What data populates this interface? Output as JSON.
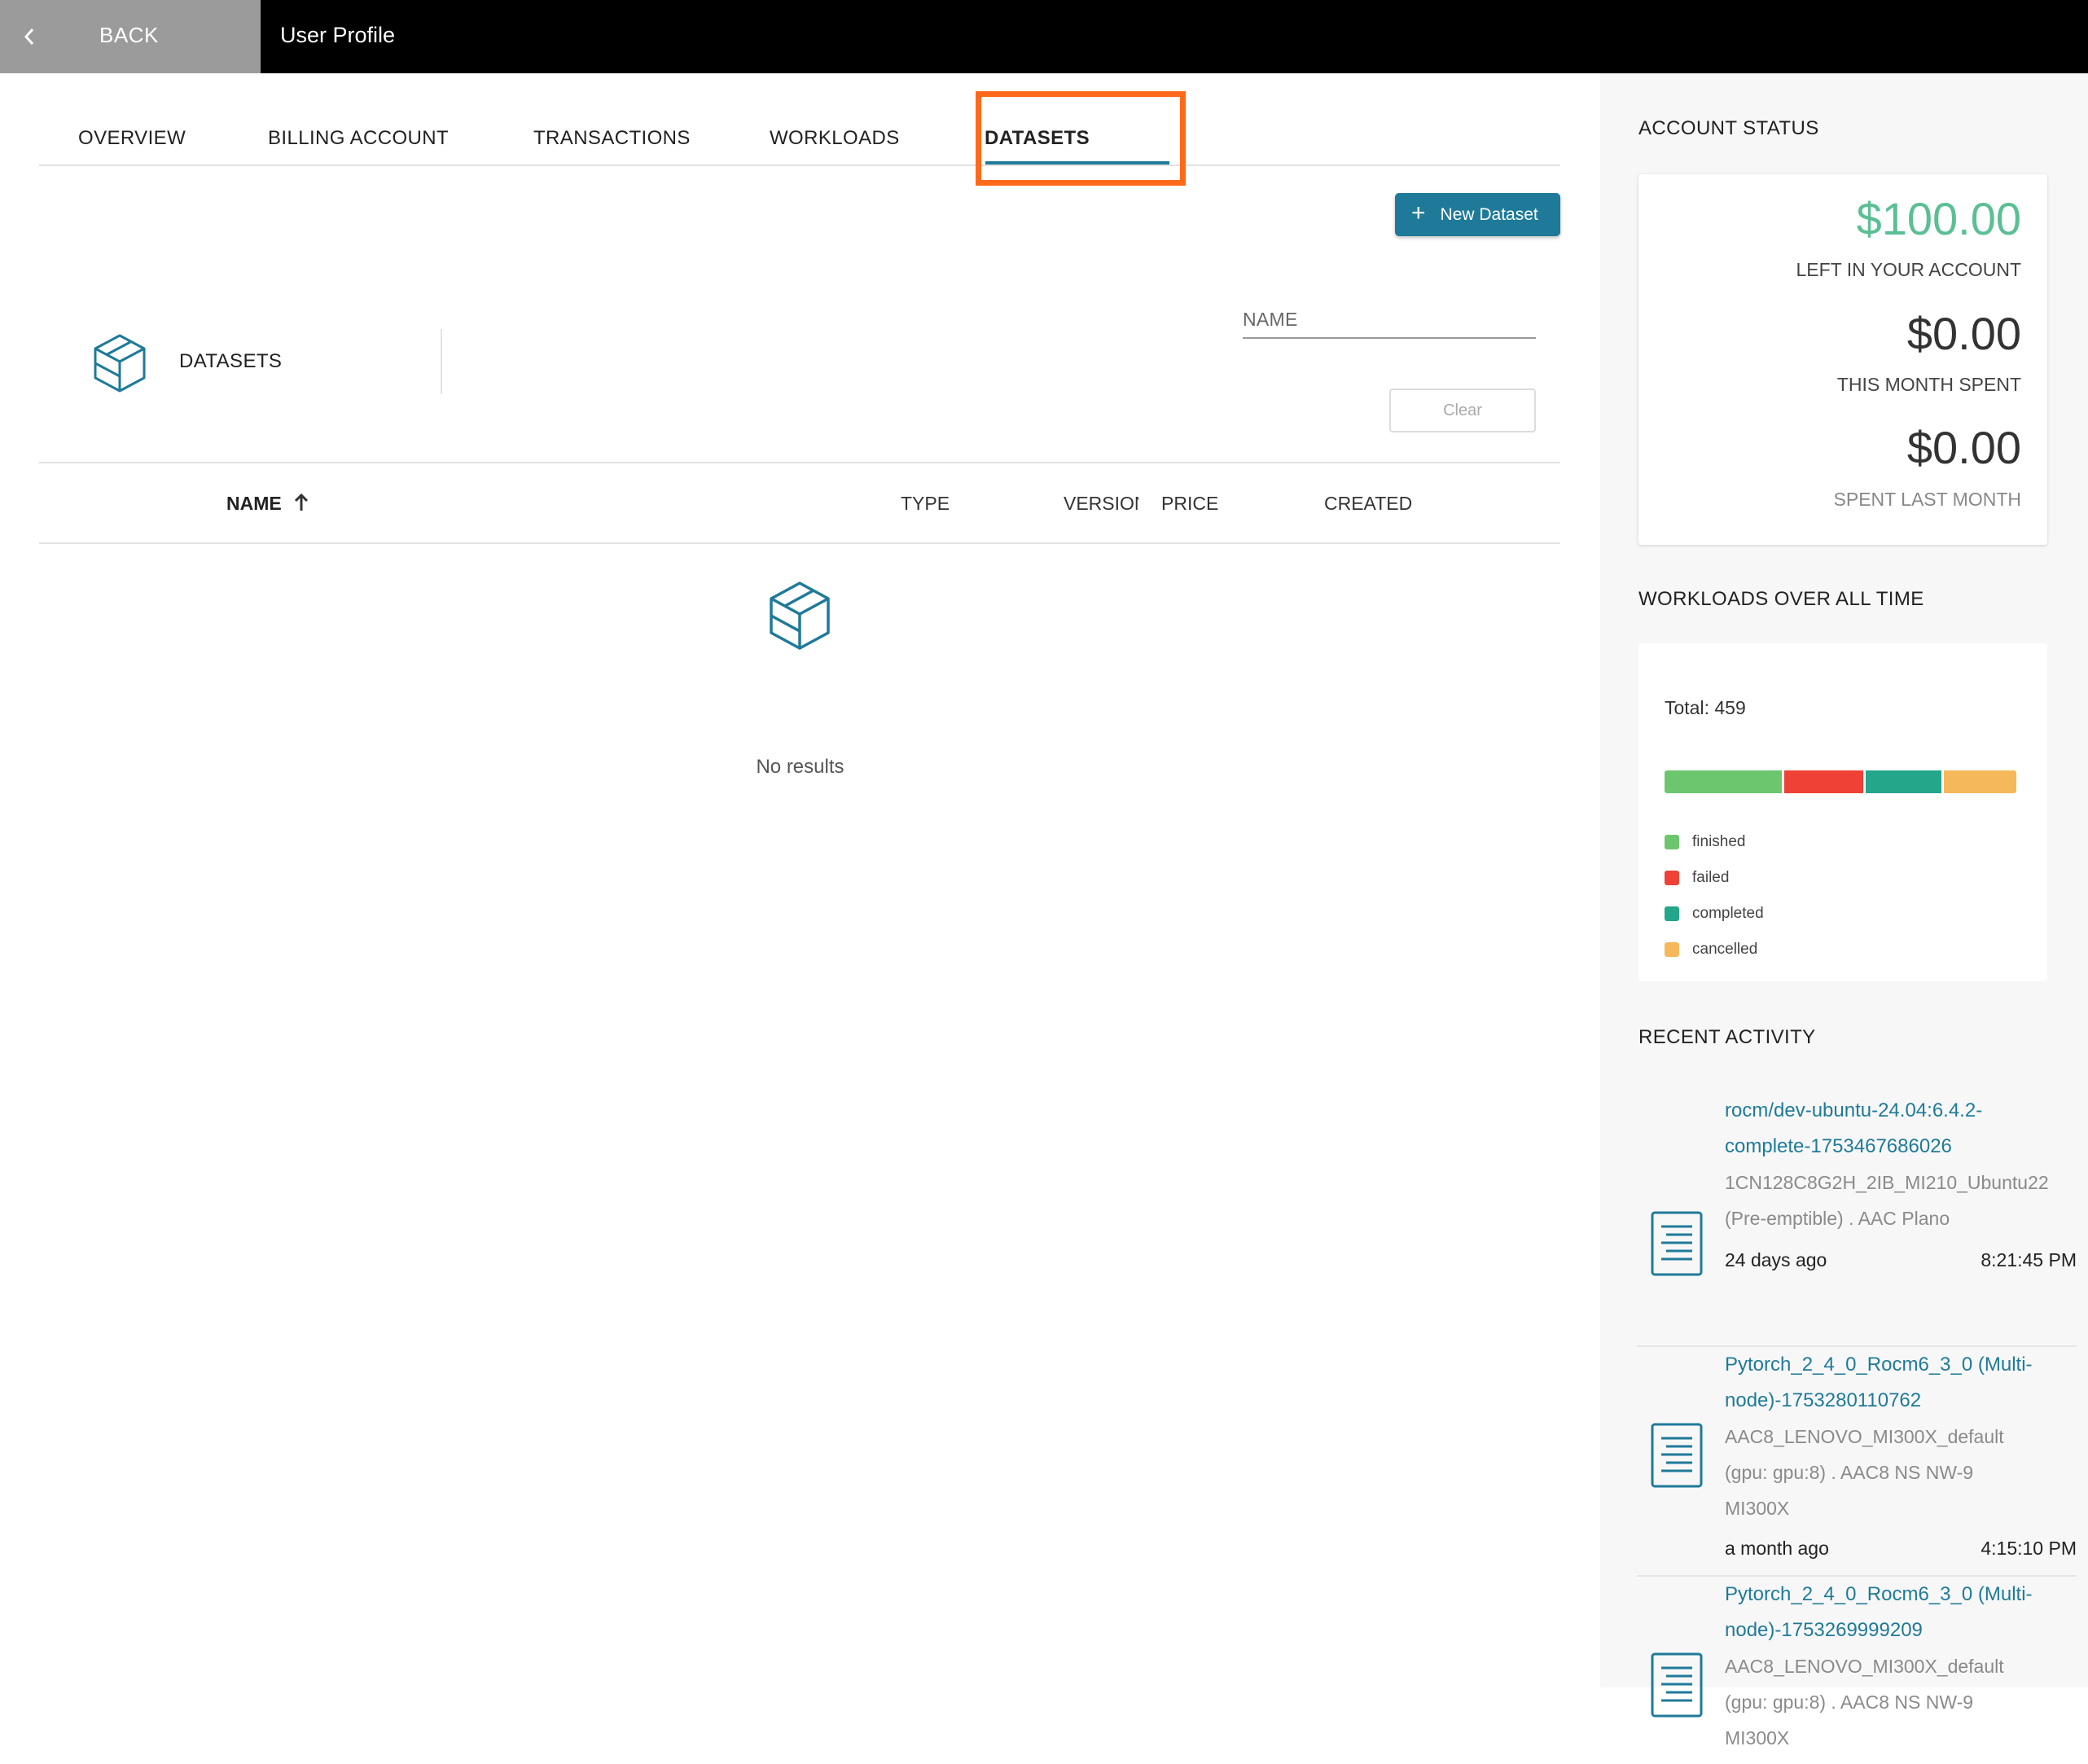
{
  "topbar": {
    "back_label": "BACK",
    "page_title": "User Profile"
  },
  "tabs": [
    {
      "label": "OVERVIEW",
      "active": false
    },
    {
      "label": "BILLING ACCOUNT",
      "active": false
    },
    {
      "label": "TRANSACTIONS",
      "active": false
    },
    {
      "label": "WORKLOADS",
      "active": false
    },
    {
      "label": "DATASETS",
      "active": true
    }
  ],
  "toolbar": {
    "new_dataset_label": "New Dataset"
  },
  "datasets_header": {
    "label": "DATASETS"
  },
  "filter": {
    "name_placeholder": "NAME",
    "clear_label": "Clear"
  },
  "table": {
    "columns": {
      "name": "NAME",
      "type": "TYPE",
      "version": "VERSION",
      "price": "PRICE",
      "created": "CREATED"
    },
    "sort_column": "name",
    "sort_direction": "ascending",
    "empty_text": "No results"
  },
  "account_status": {
    "title": "ACCOUNT STATUS",
    "left_amount": "$100.00",
    "left_label": "LEFT IN YOUR ACCOUNT",
    "month_amount": "$0.00",
    "month_label": "THIS MONTH SPENT",
    "last_amount": "$0.00",
    "last_label": "SPENT LAST MONTH"
  },
  "workloads": {
    "title": "WORKLOADS OVER ALL TIME",
    "total_text": "Total: 459",
    "segments": [
      {
        "label": "finished",
        "color": "#6cc66e",
        "fraction": 0.34
      },
      {
        "label": "failed",
        "color": "#ef4136",
        "fraction": 0.23
      },
      {
        "label": "completed",
        "color": "#23a68a",
        "fraction": 0.22
      },
      {
        "label": "cancelled",
        "color": "#f5b95b",
        "fraction": 0.21
      }
    ]
  },
  "recent_activity": {
    "title": "RECENT ACTIVITY",
    "items": [
      {
        "title": "rocm/dev-ubuntu-24.04:6.4.2-complete-1753467686026",
        "sub1": "1CN128C8G2H_2IB_MI210_Ubuntu22",
        "sub2": "(Pre-emptible) . AAC Plano",
        "ago": "24 days ago",
        "time": "8:21:45 PM"
      },
      {
        "title": "Pytorch_2_4_0_Rocm6_3_0 (Multi-node)-1753280110762",
        "sub1": "AAC8_LENOVO_MI300X_default",
        "sub2": "(gpu: gpu:8) . AAC8 NS NW-9",
        "sub3": "MI300X",
        "ago": "a month ago",
        "time": "4:15:10 PM"
      },
      {
        "title": "Pytorch_2_4_0_Rocm6_3_0 (Multi-node)-1753269999209",
        "sub1": "AAC8_LENOVO_MI300X_default",
        "sub2": "(gpu: gpu:8) . AAC8 NS NW-9",
        "sub3": "MI300X"
      }
    ]
  },
  "icons": {
    "back": "chevron-left-icon",
    "add": "plus-icon",
    "datasets": "cube-icon",
    "sort": "arrow-up-icon",
    "activity": "document-icon"
  }
}
